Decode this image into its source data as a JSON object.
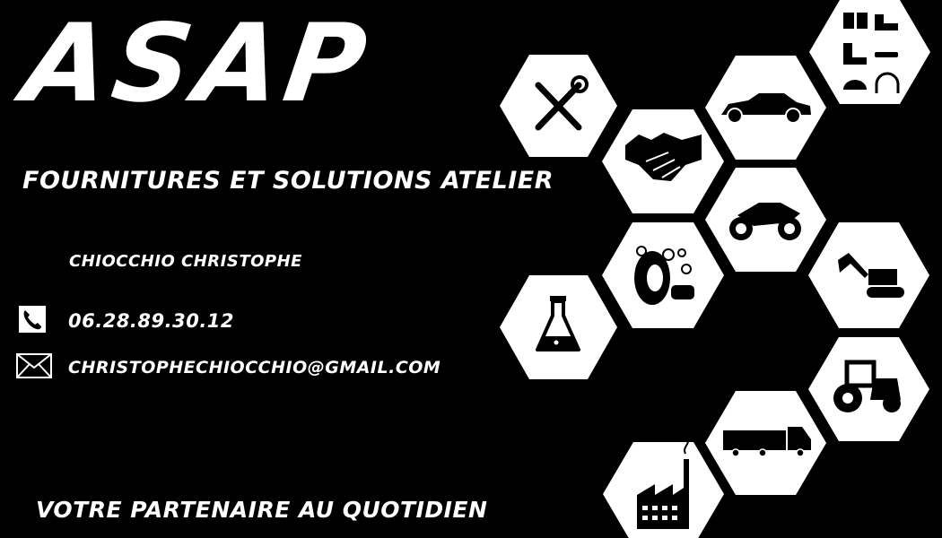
{
  "brand": {
    "logo_text": "ASAP"
  },
  "tagline": "FOURNiTURES ET SOLUTiONS ATELiER",
  "contact": {
    "name": "CHiOCCHiO CHRiSTOPHE",
    "phone": "06.28.89.30.12",
    "email": "CHRiSTOPHECHiOCCHiO@GMAiL.COM"
  },
  "footer": "VOTRE PARTENAiRE AU QUOTiDiEN",
  "hexagons": [
    {
      "name": "tools-icon"
    },
    {
      "name": "safety-equipment-icon"
    },
    {
      "name": "car-icon"
    },
    {
      "name": "handshake-icon"
    },
    {
      "name": "motorcycle-icon"
    },
    {
      "name": "tire-cleaning-icon"
    },
    {
      "name": "excavator-icon"
    },
    {
      "name": "chemistry-flask-icon"
    },
    {
      "name": "tractor-icon"
    },
    {
      "name": "truck-icon"
    },
    {
      "name": "factory-icon"
    }
  ]
}
